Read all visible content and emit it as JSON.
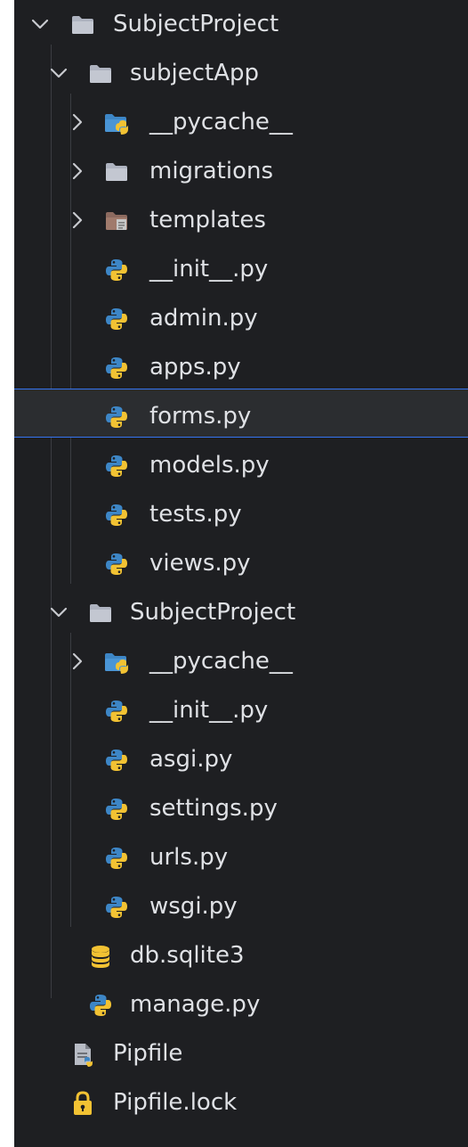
{
  "tree": {
    "root": {
      "name": "SubjectProject",
      "icon": "folder-icon",
      "expanded": true
    },
    "app": {
      "name": "subjectApp",
      "icon": "folder-icon",
      "expanded": true
    },
    "app_pycache": {
      "name": "__pycache__",
      "icon": "python-package-folder-icon",
      "expanded": false
    },
    "migrations": {
      "name": "migrations",
      "icon": "folder-icon",
      "expanded": false
    },
    "templates": {
      "name": "templates",
      "icon": "templates-folder-icon",
      "expanded": false
    },
    "app_init": {
      "name": "__init__.py",
      "icon": "python-file-icon"
    },
    "admin": {
      "name": "admin.py",
      "icon": "python-file-icon"
    },
    "apps": {
      "name": "apps.py",
      "icon": "python-file-icon"
    },
    "forms": {
      "name": "forms.py",
      "icon": "python-file-icon",
      "selected": true
    },
    "models": {
      "name": "models.py",
      "icon": "python-file-icon"
    },
    "tests": {
      "name": "tests.py",
      "icon": "python-file-icon"
    },
    "views": {
      "name": "views.py",
      "icon": "python-file-icon"
    },
    "project": {
      "name": "SubjectProject",
      "icon": "folder-icon",
      "expanded": true
    },
    "proj_pycache": {
      "name": "__pycache__",
      "icon": "python-package-folder-icon",
      "expanded": false
    },
    "proj_init": {
      "name": "__init__.py",
      "icon": "python-file-icon"
    },
    "asgi": {
      "name": "asgi.py",
      "icon": "python-file-icon"
    },
    "settings": {
      "name": "settings.py",
      "icon": "python-file-icon"
    },
    "urls": {
      "name": "urls.py",
      "icon": "python-file-icon"
    },
    "wsgi": {
      "name": "wsgi.py",
      "icon": "python-file-icon"
    },
    "db": {
      "name": "db.sqlite3",
      "icon": "database-icon"
    },
    "manage": {
      "name": "manage.py",
      "icon": "python-file-icon"
    },
    "pipfile": {
      "name": "Pipfile",
      "icon": "pipfile-icon"
    },
    "pipfile_lock": {
      "name": "Pipfile.lock",
      "icon": "lock-icon"
    }
  },
  "colors": {
    "background": "#1e1f22",
    "selection_background": "#2b2d30",
    "selection_border": "#3574f0",
    "text": "#dfe1e5",
    "folder": "#aeb3c0",
    "python_blue": "#3d86c6",
    "python_yellow": "#f2c233"
  }
}
